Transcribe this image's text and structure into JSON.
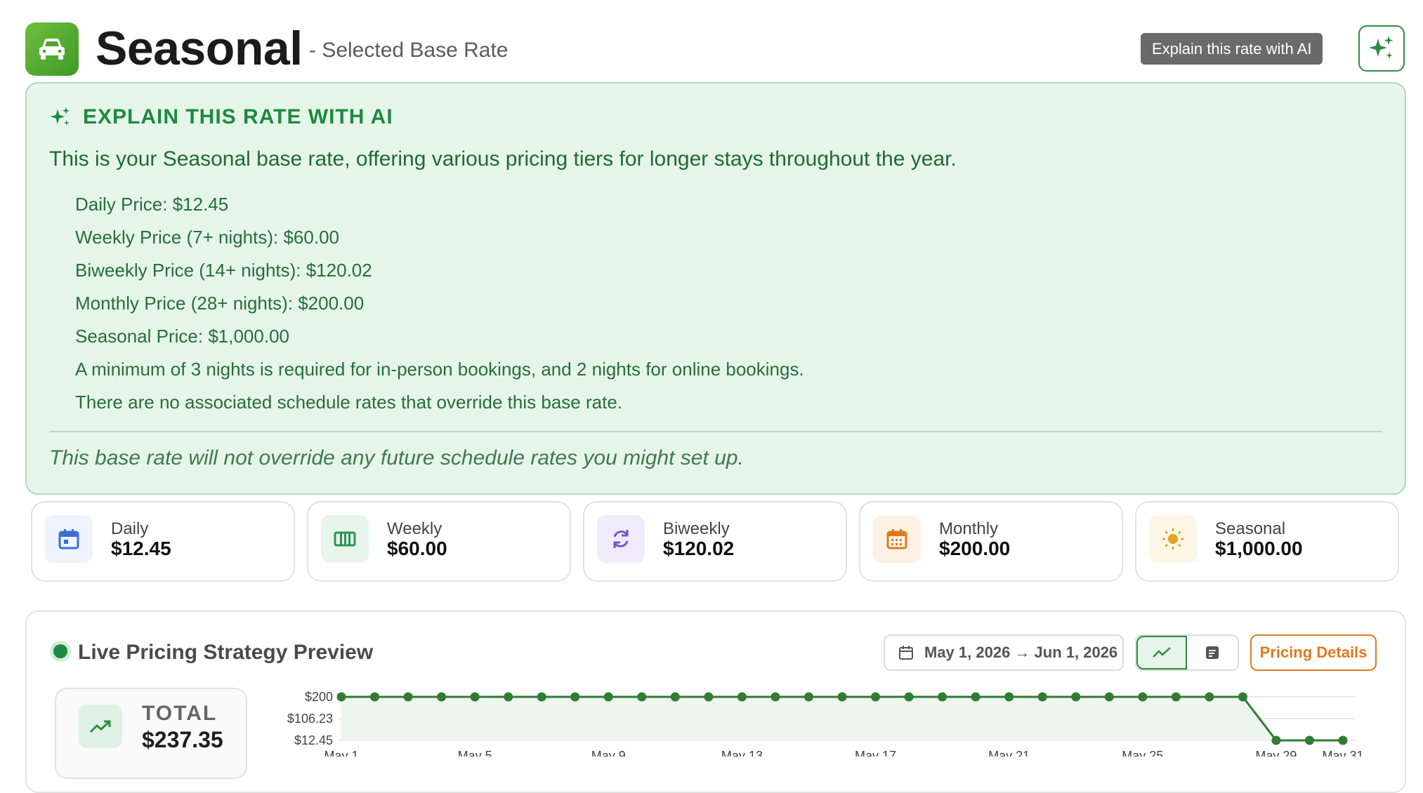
{
  "header": {
    "title": "Seasonal",
    "subtitle": "- Selected Base Rate",
    "tooltip": "Explain this rate with AI",
    "app_icon": "car-icon",
    "ai_button_icon": "sparkles-icon"
  },
  "ai_panel": {
    "heading": "EXPLAIN THIS RATE WITH AI",
    "summary": "This is your Seasonal base rate, offering various pricing tiers for longer stays throughout the year.",
    "lines": [
      "Daily Price: $12.45",
      "Weekly Price (7+ nights): $60.00",
      "Biweekly Price (14+ nights): $120.02",
      "Monthly Price (28+ nights): $200.00",
      "Seasonal Price: $1,000.00",
      "A minimum of 3 nights is required for in-person bookings, and 2 nights for online bookings.",
      "There are no associated schedule rates that override this base rate."
    ],
    "footnote": "This base rate will not override any future schedule rates you might set up."
  },
  "stats": [
    {
      "label": "Daily",
      "value": "$12.45",
      "icon": "calendar-day-icon",
      "color": "#3b6fd8",
      "bg": "#eef3fc"
    },
    {
      "label": "Weekly",
      "value": "$60.00",
      "icon": "calendar-week-icon",
      "color": "#2f9350",
      "bg": "#e8f5ec"
    },
    {
      "label": "Biweekly",
      "value": "$120.02",
      "icon": "refresh-icon",
      "color": "#7a52cc",
      "bg": "#f1ecfb"
    },
    {
      "label": "Monthly",
      "value": "$200.00",
      "icon": "calendar-month-icon",
      "color": "#e07a1f",
      "bg": "#fdf1e6"
    },
    {
      "label": "Seasonal",
      "value": "$1,000.00",
      "icon": "sun-icon",
      "color": "#e0a31f",
      "bg": "#fdf6e6"
    }
  ],
  "preview": {
    "title": "Live Pricing Strategy Preview",
    "date_range": "May 1, 2026 → Jun 1, 2026",
    "pricing_details_label": "Pricing Details",
    "total_label": "TOTAL",
    "total_value": "$237.35"
  },
  "colors": {
    "brand_green": "#2e8b46",
    "panel_bg": "#e6f5ea",
    "accent_orange": "#e07a1f"
  },
  "chart_data": {
    "type": "line",
    "x": [
      "May 1",
      "May 2",
      "May 3",
      "May 4",
      "May 5",
      "May 6",
      "May 7",
      "May 8",
      "May 9",
      "May 10",
      "May 11",
      "May 12",
      "May 13",
      "May 14",
      "May 15",
      "May 16",
      "May 17",
      "May 18",
      "May 19",
      "May 20",
      "May 21",
      "May 22",
      "May 23",
      "May 24",
      "May 25",
      "May 26",
      "May 27",
      "May 28",
      "May 29",
      "May 30",
      "May 31"
    ],
    "tick_labels": [
      "May 1",
      "May 5",
      "May 9",
      "May 13",
      "May 17",
      "May 21",
      "May 25",
      "May 29",
      "May 31"
    ],
    "y_tick_labels": [
      "$200",
      "$106.23",
      "$12.45"
    ],
    "series": [
      {
        "values": [
          200,
          200,
          200,
          200,
          200,
          200,
          200,
          200,
          200,
          200,
          200,
          200,
          200,
          200,
          200,
          200,
          200,
          200,
          200,
          200,
          200,
          200,
          200,
          200,
          200,
          200,
          200,
          200,
          12.45,
          12.45,
          12.45
        ]
      }
    ],
    "ylim": [
      12.45,
      200
    ],
    "color": "#2e7d32",
    "fill": "#eef5ef",
    "grid": true
  }
}
